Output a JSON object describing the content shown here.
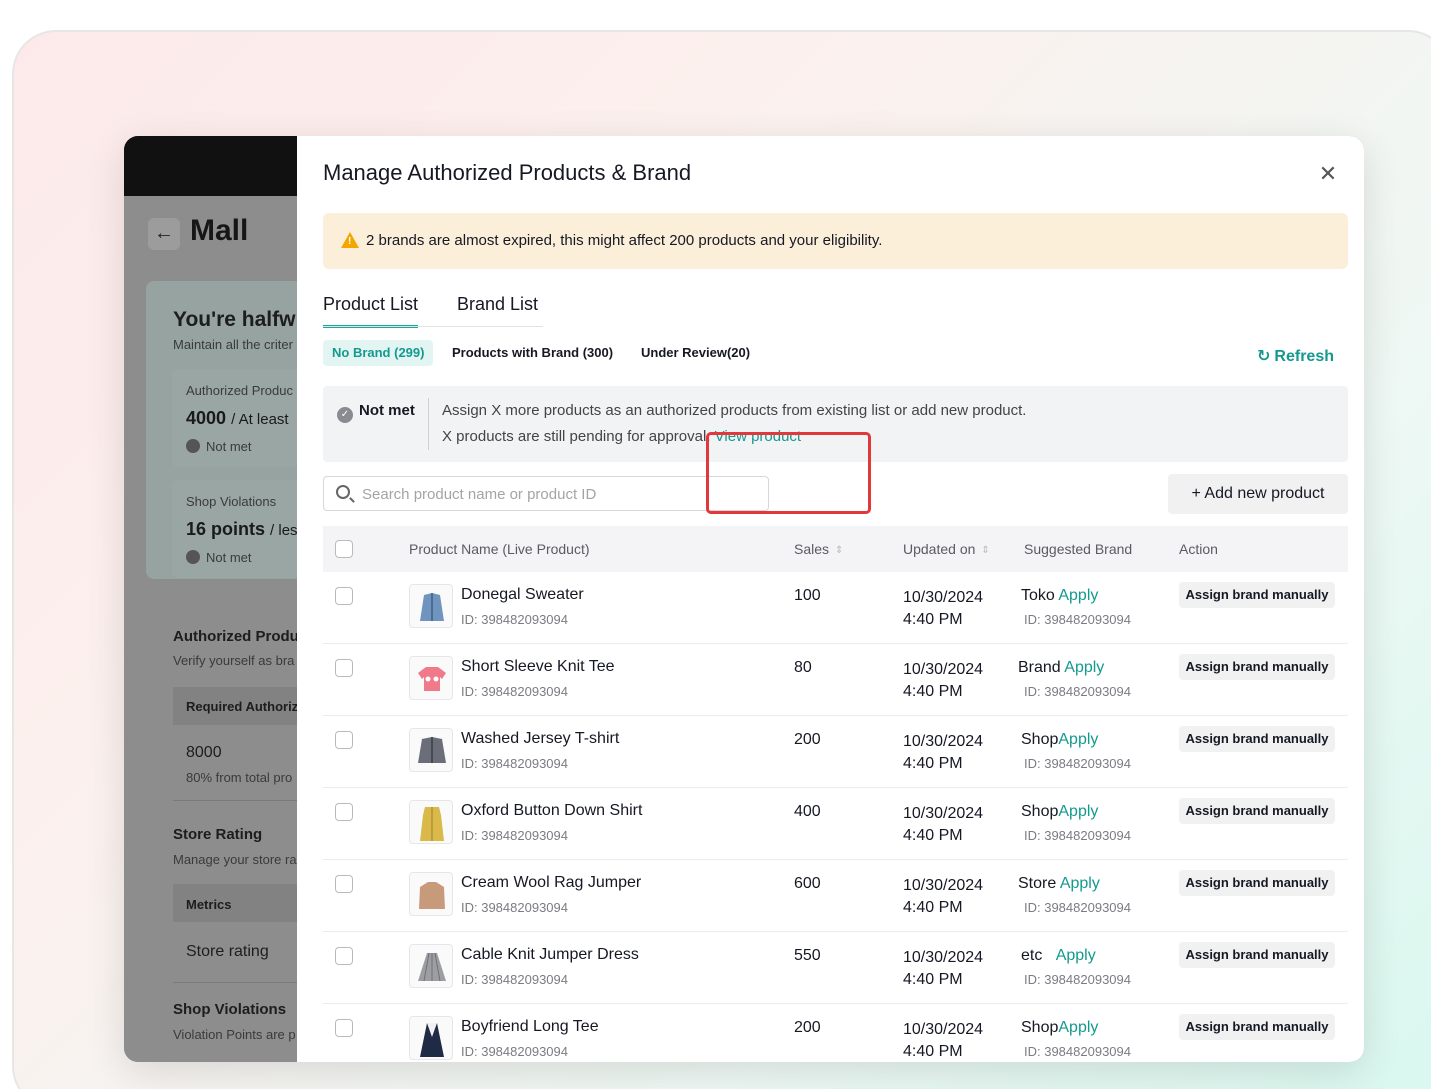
{
  "background_page": {
    "title": "Mall",
    "heading": "You're halfw",
    "subheading": "Maintain all the criter",
    "authorized_label": "Authorized Produc",
    "authorized_value": "4000",
    "authorized_suffix": "/ At least",
    "authorized_status": "Not met",
    "violations_label": "Shop Violations",
    "violations_value": "16 points",
    "violations_suffix": "/ less",
    "violations_status": "Not met",
    "sec1_title": "Authorized Produ",
    "sec1_sub": "Verify yourself as bra",
    "sec1_th": "Required Authoriz",
    "sec1_val": "8000",
    "sec1_val_sub": "80% from total pro",
    "sec2_title": "Store Rating",
    "sec2_sub": "Manage your store ra",
    "sec2_th": "Metrics",
    "sec2_val": "Store rating",
    "sec3_title": "Shop Violations",
    "sec3_sub": "Violation Points are p"
  },
  "modal": {
    "title": "Manage Authorized Products & Brand",
    "close_icon": "close-icon",
    "alert_text": "2 brands are almost expired, this might affect 200 products and your eligibility.",
    "tabs": [
      {
        "label": "Product List",
        "active": true
      },
      {
        "label": "Brand List",
        "active": false
      }
    ],
    "subtabs": [
      {
        "label": "No Brand (299)",
        "active": true
      },
      {
        "label": "Products with Brand (300)",
        "active": false
      },
      {
        "label": "Under Review(20)",
        "active": false
      }
    ],
    "refresh_label": "Refresh",
    "notice": {
      "badge": "Not met",
      "line1": "Assign X more products as an authorized products from existing list or add new product.",
      "line2": "X products are still pending for approval.",
      "link": "View product"
    },
    "search_placeholder": "Search product name or product ID",
    "add_button": "+ Add new product",
    "columns": {
      "product": "Product Name (Live Product)",
      "sales": "Sales",
      "updated": "Updated on",
      "brand": "Suggested Brand",
      "action": "Action"
    },
    "rows": [
      {
        "name": "Donegal Sweater",
        "id": "ID: 398482093094",
        "sales": "100",
        "date": "10/30/2024",
        "time": "4:40 PM",
        "brand": "Toko",
        "apply": "Apply",
        "brand_id": "ID: 398482093094",
        "action": "Assign brand manually"
      },
      {
        "name": "Short Sleeve Knit Tee",
        "id": "ID: 398482093094",
        "sales": "80",
        "date": "10/30/2024",
        "time": "4:40 PM",
        "brand": "Brand",
        "apply": "Apply",
        "brand_id": "ID: 398482093094",
        "action": "Assign brand manually"
      },
      {
        "name": "Washed Jersey T-shirt",
        "id": "ID: 398482093094",
        "sales": "200",
        "date": "10/30/2024",
        "time": "4:40 PM",
        "brand": "Shop",
        "apply": "Apply",
        "brand_id": "ID: 398482093094",
        "action": "Assign brand manually"
      },
      {
        "name": "Oxford Button Down Shirt",
        "id": "ID: 398482093094",
        "sales": "400",
        "date": "10/30/2024",
        "time": "4:40 PM",
        "brand": "Shop",
        "apply": "Apply",
        "brand_id": "ID: 398482093094",
        "action": "Assign brand manually"
      },
      {
        "name": "Cream Wool Rag Jumper",
        "id": "ID: 398482093094",
        "sales": "600",
        "date": "10/30/2024",
        "time": "4:40 PM",
        "brand": "Store",
        "apply": "Apply",
        "brand_id": "ID: 398482093094",
        "action": "Assign brand manually"
      },
      {
        "name": "Cable Knit Jumper Dress",
        "id": "ID: 398482093094",
        "sales": "550",
        "date": "10/30/2024",
        "time": "4:40 PM",
        "brand": "etc",
        "apply": "Apply",
        "brand_id": "ID: 398482093094",
        "action": "Assign brand manually"
      },
      {
        "name": "Boyfriend Long Tee",
        "id": "ID: 398482093094",
        "sales": "200",
        "date": "10/30/2024",
        "time": "4:40 PM",
        "brand": "Shop",
        "apply": "Apply",
        "brand_id": "ID: 398482093094",
        "action": "Assign brand manually"
      }
    ]
  },
  "colors": {
    "accent": "#14998f",
    "warning_bg": "#fcefd9",
    "warning_icon": "#f3a600",
    "highlight": "#e2373b"
  }
}
